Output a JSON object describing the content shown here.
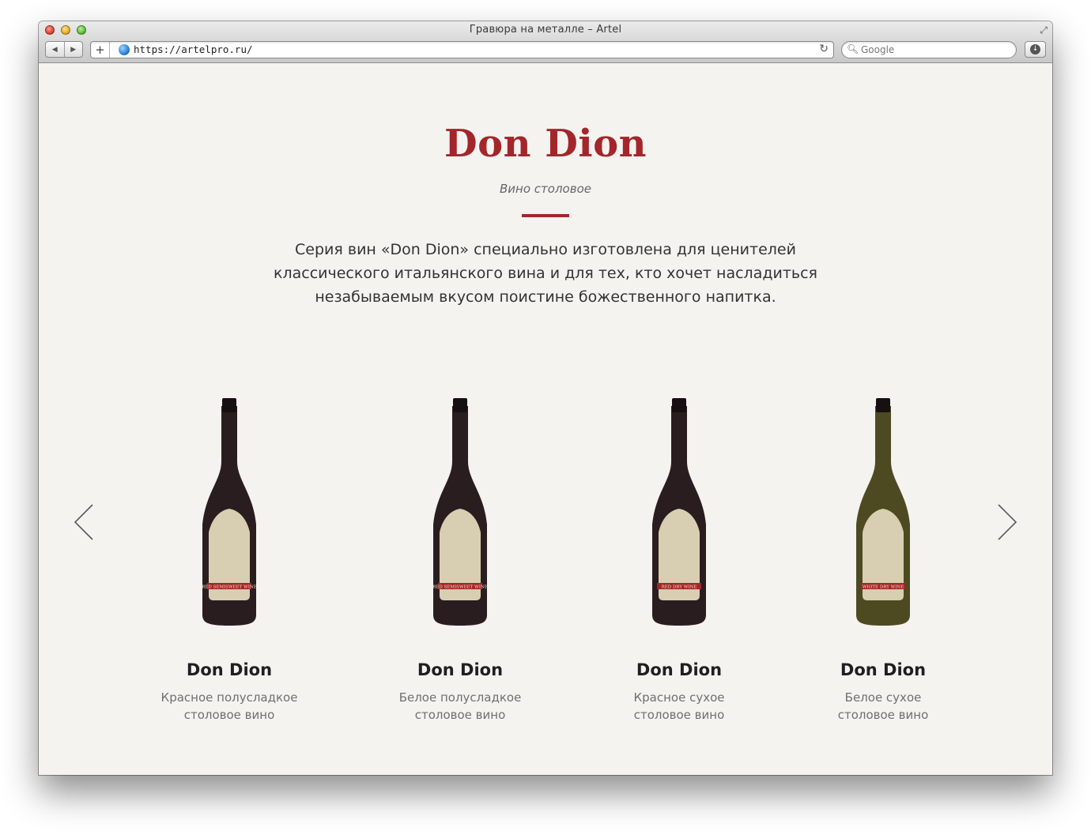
{
  "browser": {
    "window_title": "Гравюра на металле – Artel",
    "url": "https://artelpro.ru/",
    "search_placeholder": "Google",
    "add_label": "+"
  },
  "page": {
    "title": "Don Dion",
    "subtitle": "Вино столовое",
    "intro": "Серия вин «Don Dion» специально изготовлена для ценителей классического итальянского вина и для тех, кто хочет насладиться незабываемым вкусом поистине божественного напитка.",
    "accent_color": "#a3262a"
  },
  "products": [
    {
      "name": "Don Dion",
      "desc_line1": "Красное полусладкое",
      "desc_line2": "столовое вино",
      "label_text": "RED SEMISWEET WINE",
      "glass": "#2a1d20"
    },
    {
      "name": "Don Dion",
      "desc_line1": "Белое полусладкое",
      "desc_line2": "столовое вино",
      "label_text": "RED SEMISWEET WINE",
      "glass": "#2a1d20"
    },
    {
      "name": "Don Dion",
      "desc_line1": "Красное сухое",
      "desc_line2": "столовое вино",
      "label_text": "RED DRY WINE",
      "glass": "#2a1d20"
    },
    {
      "name": "Don Dion",
      "desc_line1": "Белое сухое",
      "desc_line2": "столовое вино",
      "label_text": "WHITE DRY WINE",
      "glass": "#4d4a22"
    }
  ],
  "icons": {
    "prev": "chevron-left-icon",
    "next": "chevron-right-icon",
    "reload": "reload-icon",
    "search": "search-icon"
  }
}
